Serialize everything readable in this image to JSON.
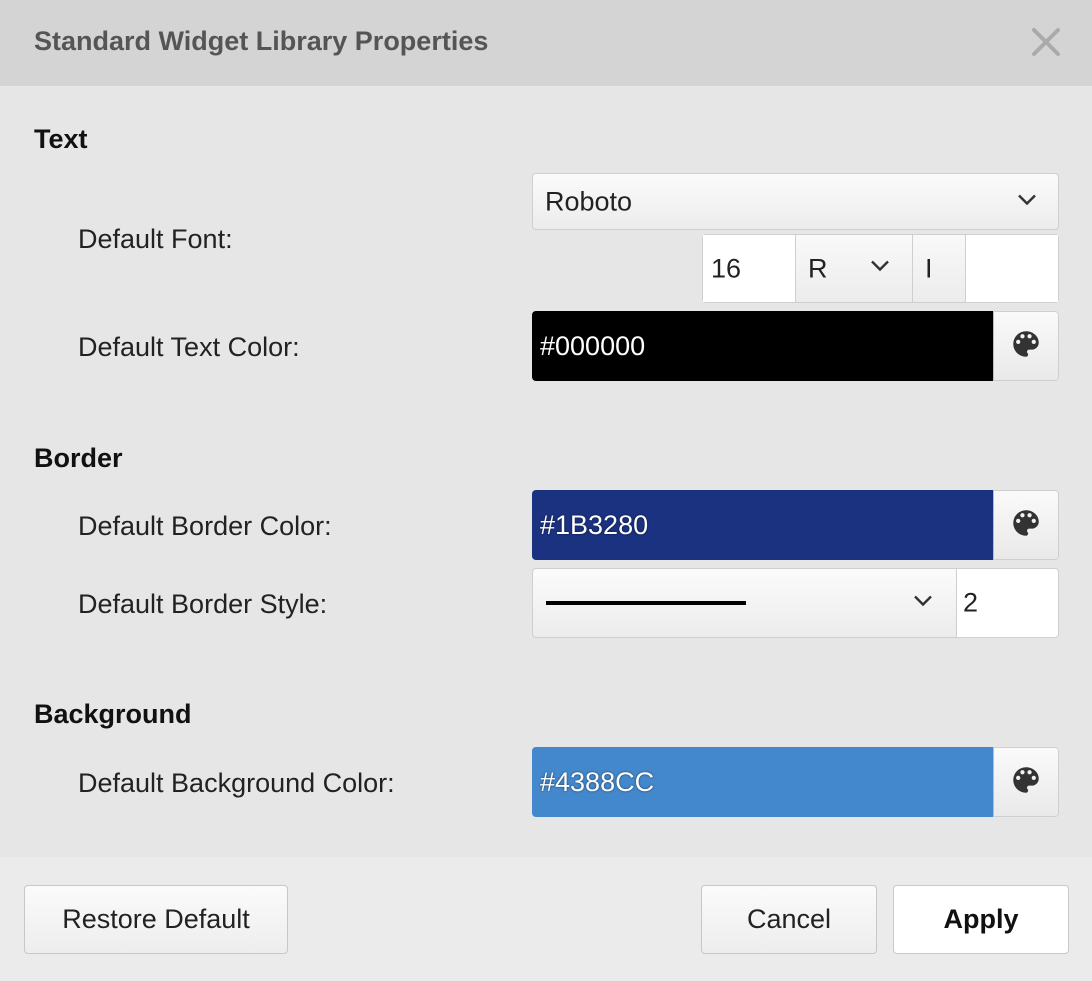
{
  "dialog": {
    "title": "Standard Widget Library Properties",
    "close_icon": "close-icon"
  },
  "text_section": {
    "heading": "Text",
    "default_font_label": "Default Font:",
    "font_family": "Roboto",
    "font_size": "16",
    "font_weight": "R",
    "font_style": "I",
    "default_text_color_label": "Default Text Color:",
    "text_color": "#000000"
  },
  "border_section": {
    "heading": "Border",
    "default_border_color_label": "Default Border Color:",
    "border_color": "#1B3280",
    "default_border_style_label": "Default Border Style:",
    "border_style": "solid",
    "border_width": "2"
  },
  "background_section": {
    "heading": "Background",
    "default_background_color_label": "Default Background Color:",
    "background_color": "#4388CC"
  },
  "footer": {
    "restore_default_label": "Restore Default",
    "cancel_label": "Cancel",
    "apply_label": "Apply"
  },
  "icons": {
    "picker": "palette-icon",
    "dropdown": "chevron-down-icon"
  }
}
